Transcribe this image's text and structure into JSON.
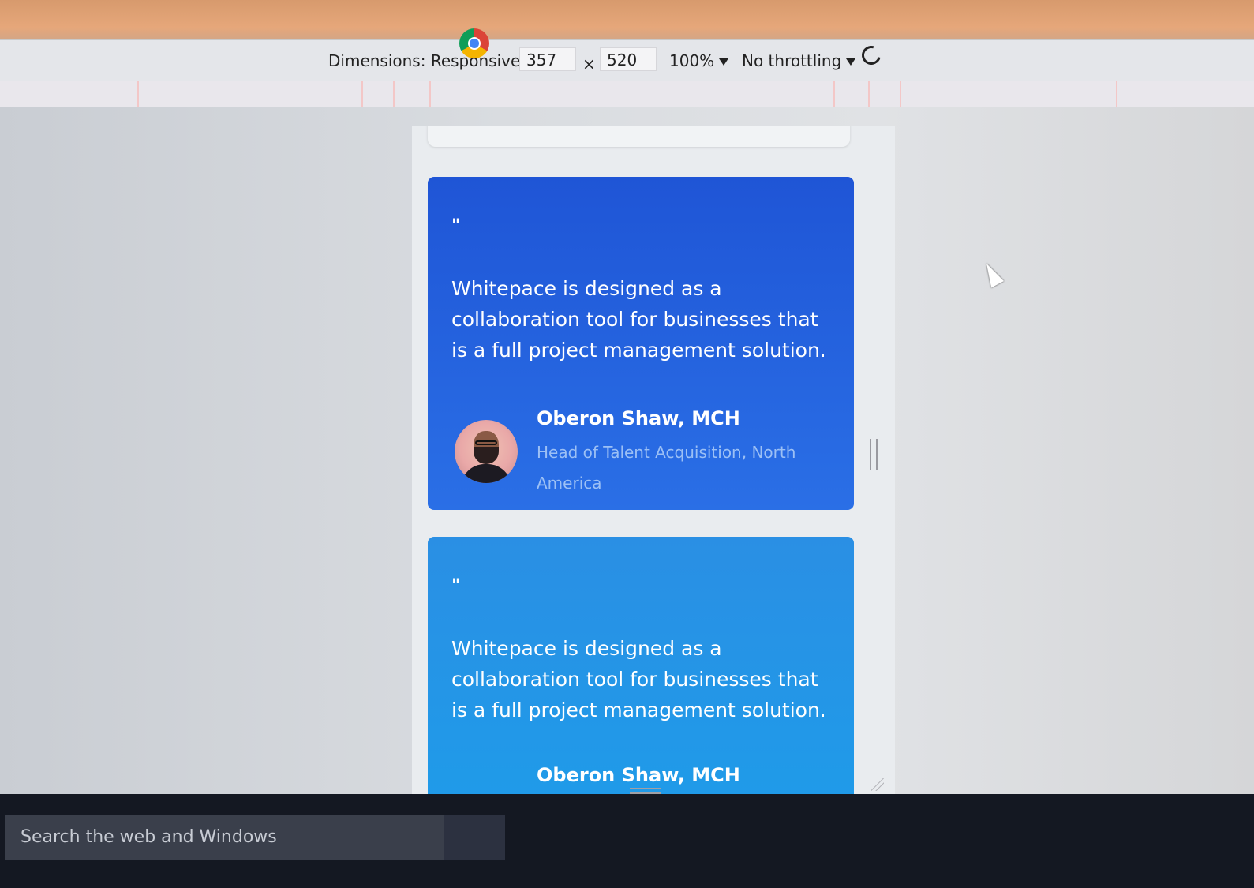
{
  "toolbar": {
    "dimensions_label": "Dimensions: Responsive",
    "width_value": "357",
    "times": "×",
    "height_value": "520",
    "zoom": "100%",
    "throttling": "No throttling"
  },
  "cards": [
    {
      "quote_mark": "\"",
      "text": "Whitepace is designed as a collaboration tool for businesses that is a full project management solution.",
      "author_name": "Oberon Shaw, MCH",
      "author_role": "Head of Talent Acquisition, North America",
      "color": "#1f55d6"
    },
    {
      "quote_mark": "\"",
      "text": "Whitepace is designed as a collaboration tool for businesses that is a full project management solution.",
      "author_name": "Oberon Shaw, MCH",
      "color": "#1f9be9"
    }
  ],
  "taskbar": {
    "search_text": "Search the web and Windows",
    "app_icon": "chrome-icon"
  }
}
